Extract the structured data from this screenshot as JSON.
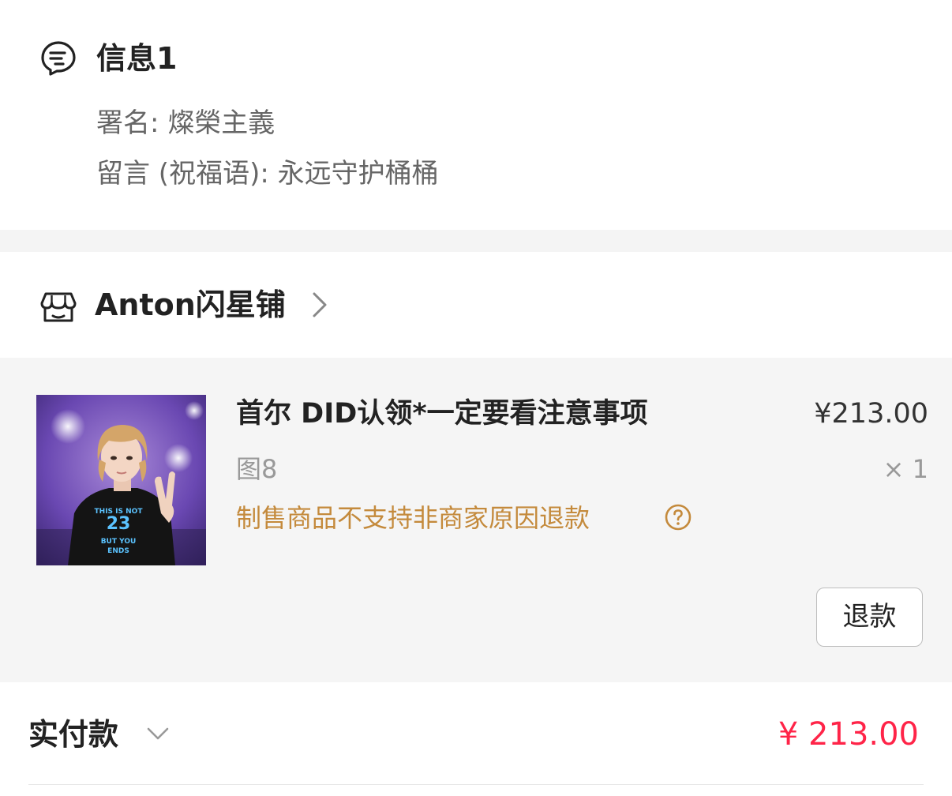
{
  "message": {
    "icon": "message-note-icon",
    "title": "信息1",
    "signature": "署名: 燦榮主義",
    "note": "留言 (祝福语): 永远守护桶桶"
  },
  "shop": {
    "icon": "shop-icon",
    "name": "Anton闪星铺",
    "chevron": "chevron-right-icon"
  },
  "product": {
    "image": "product-photo",
    "title": "首尔 DID认领*一定要看注意事项",
    "variant": "图8",
    "notice": "制售商品不支持非商家原因退款",
    "notice_help_icon": "question-circle-icon",
    "price": "¥213.00",
    "quantity": "× 1",
    "refund_label": "退款",
    "notice_color": "#c48a3c"
  },
  "payment": {
    "label": "实付款",
    "amount": "¥ 213.00",
    "amount_color": "#ff2448",
    "chevron": "chevron-down-icon"
  }
}
